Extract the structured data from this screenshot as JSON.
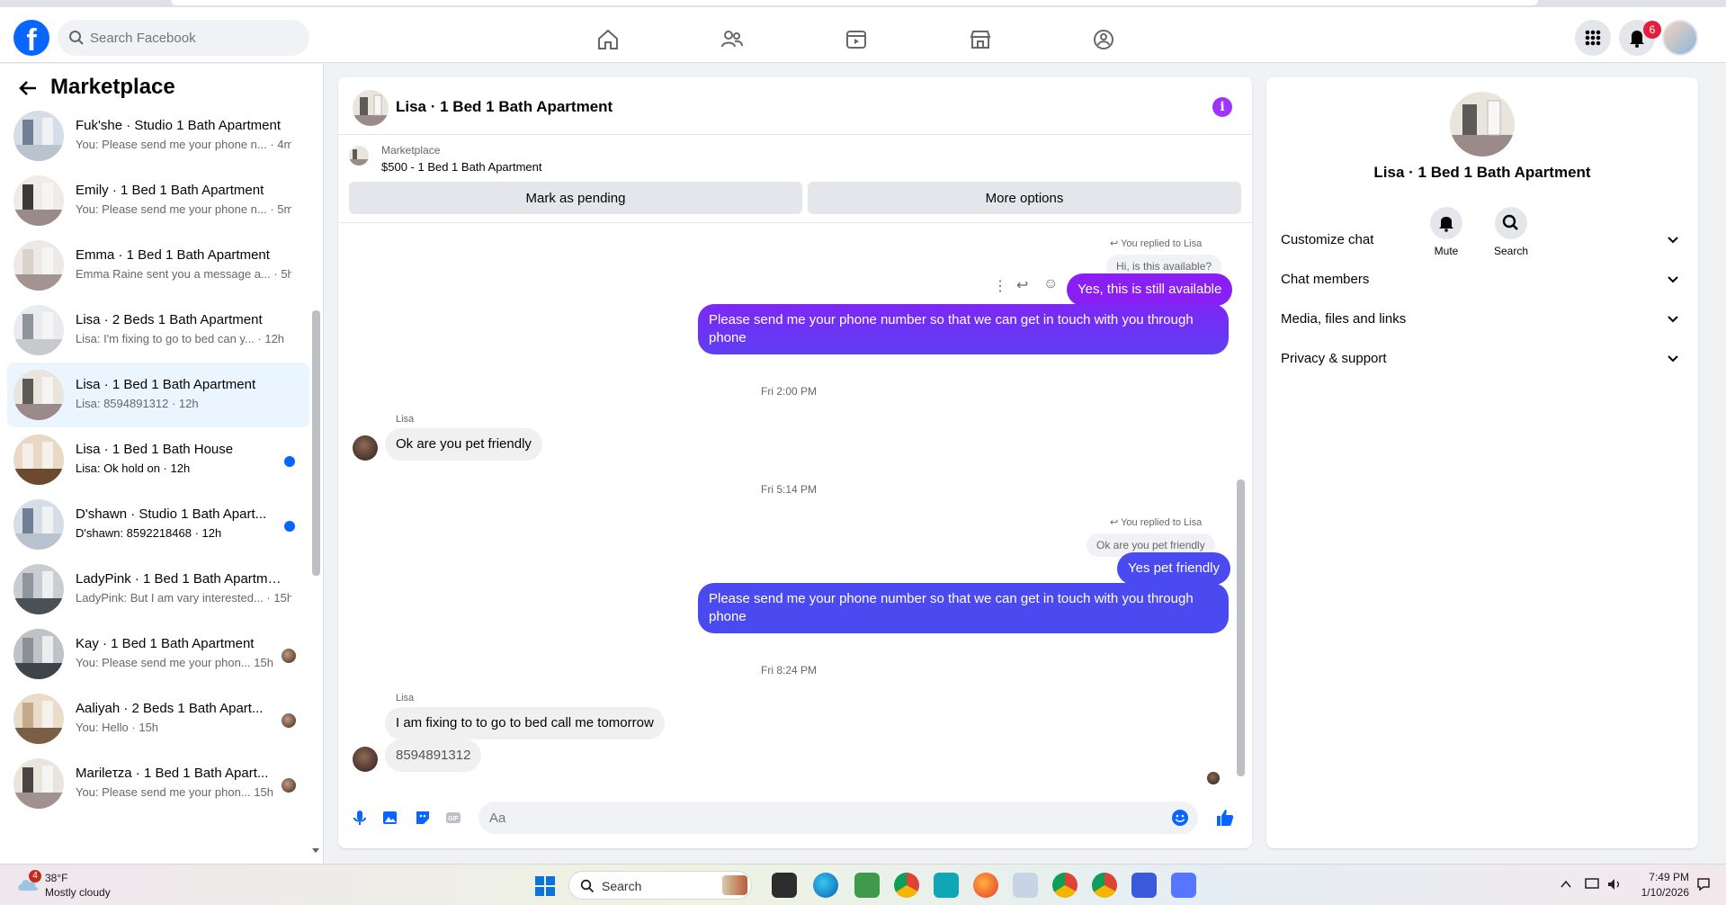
{
  "topnav": {
    "search_placeholder": "Search Facebook",
    "notification_count": "6",
    "logo_letter": "f"
  },
  "sidebar": {
    "title": "Marketplace",
    "conversations": [
      {
        "title": "",
        "preview": "You: Please send me your phone n... · 4m",
        "state": "read"
      },
      {
        "title": "Fuk'she · Studio 1 Bath Apartment",
        "preview": "You: Please send me your phone n... · 4m",
        "state": "read"
      },
      {
        "title": "Emily · 1 Bed 1 Bath Apartment",
        "preview": "You: Please send me your phone n... · 5m",
        "state": "read"
      },
      {
        "title": "Emma · 1 Bed 1 Bath Apartment",
        "preview": "Emma Raine sent you a message a... · 5h",
        "state": "read"
      },
      {
        "title": "Lisa · 2 Beds 1 Bath Apartment",
        "preview": "Lisa: I'm fixing to go to bed can y... · 12h",
        "state": "read"
      },
      {
        "title": "Lisa · 1 Bed 1 Bath Apartment",
        "preview": "Lisa: 8594891312 · 12h",
        "state": "active"
      },
      {
        "title": "Lisa · 1 Bed 1 Bath House",
        "preview": "Lisa: Ok hold on · 12h",
        "state": "unread"
      },
      {
        "title": "D'shawn · Studio 1 Bath Apart...",
        "preview": "D'shawn: 8592218468 · 12h",
        "state": "unread"
      },
      {
        "title": "LadyPink · 1 Bed 1 Bath Apartme...",
        "preview": "LadyPink: But I am vary interested... · 15h",
        "state": "read"
      },
      {
        "title": "Kay · 1 Bed 1 Bath Apartment",
        "preview": "You: Please send me your phon... 15h",
        "state": "seen"
      },
      {
        "title": "Aaliyah · 2 Beds 1 Bath Apart...",
        "preview": "You: Hello · 15h",
        "state": "seen"
      },
      {
        "title": "Marileτza · 1 Bed 1 Bath Apart...",
        "preview": "You: Please send me your phon... 15h",
        "state": "seen"
      }
    ]
  },
  "chat": {
    "title": "Lisa · 1 Bed 1 Bath Apartment",
    "info_glyph": "i",
    "listing_source": "Marketplace",
    "listing_price": "$500 - 1 Bed 1 Bath Apartment",
    "mark_pending_label": "Mark as pending",
    "more_options_label": "More options",
    "reply_note_1": "You replied to Lisa",
    "quoted_1": "Hi, is this available?",
    "out_1": "Yes, this is still available",
    "out_2": "Please send me your phone  number so that we can get in touch with you through phone",
    "time_1": "Fri 2:00 PM",
    "sender_1": "Lisa",
    "in_1": "Ok are you pet friendly",
    "time_2": "Fri 5:14 PM",
    "reply_note_2": "You replied to Lisa",
    "quoted_2": "Ok are you pet friendly",
    "out_3": "Yes pet friendly",
    "out_4": "Please send me your phone  number so that we can get in touch with you through phone",
    "time_3": "Fri 8:24 PM",
    "sender_2": "Lisa",
    "in_2": "I am fixing to to go to bed call me tomorrow",
    "in_3": "8594891312",
    "composer_placeholder": "Aa"
  },
  "info_panel": {
    "name": "Lisa · 1 Bed 1 Bath Apartment",
    "mute_label": "Mute",
    "search_label": "Search",
    "sections": [
      "Customize chat",
      "Chat members",
      "Media, files and links",
      "Privacy & support"
    ]
  },
  "taskbar": {
    "weather_temp": "38°F",
    "weather_condition": "Mostly cloudy",
    "weather_badge": "4",
    "search_label": "Search",
    "time": "7:49 PM",
    "date": "1/10/2026"
  },
  "colors": {
    "accent": "#0866ff",
    "outgoing_purple": "#8a1ff4",
    "outgoing_blue": "#4a4af0",
    "active_conversation": "#ebf5ff"
  }
}
